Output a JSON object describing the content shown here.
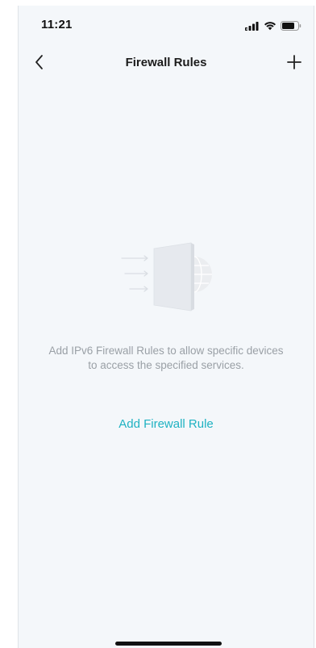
{
  "status_bar": {
    "time": "11:21",
    "icons": [
      "cellular-signal-icon",
      "wifi-icon",
      "battery-icon"
    ]
  },
  "nav": {
    "title": "Firewall Rules",
    "back_icon": "chevron-left-icon",
    "add_icon": "plus-icon"
  },
  "empty_state": {
    "illustration": "firewall-illustration-icon",
    "message_line1": "Add IPv6 Firewall Rules to allow specific devices",
    "message_line2": "to access the specified services.",
    "action_label": "Add Firewall Rule"
  },
  "colors": {
    "background": "#f4f7fa",
    "accent": "#1fb2c2",
    "muted_text": "#9aa0a6",
    "title_text": "#1c1c1c"
  }
}
